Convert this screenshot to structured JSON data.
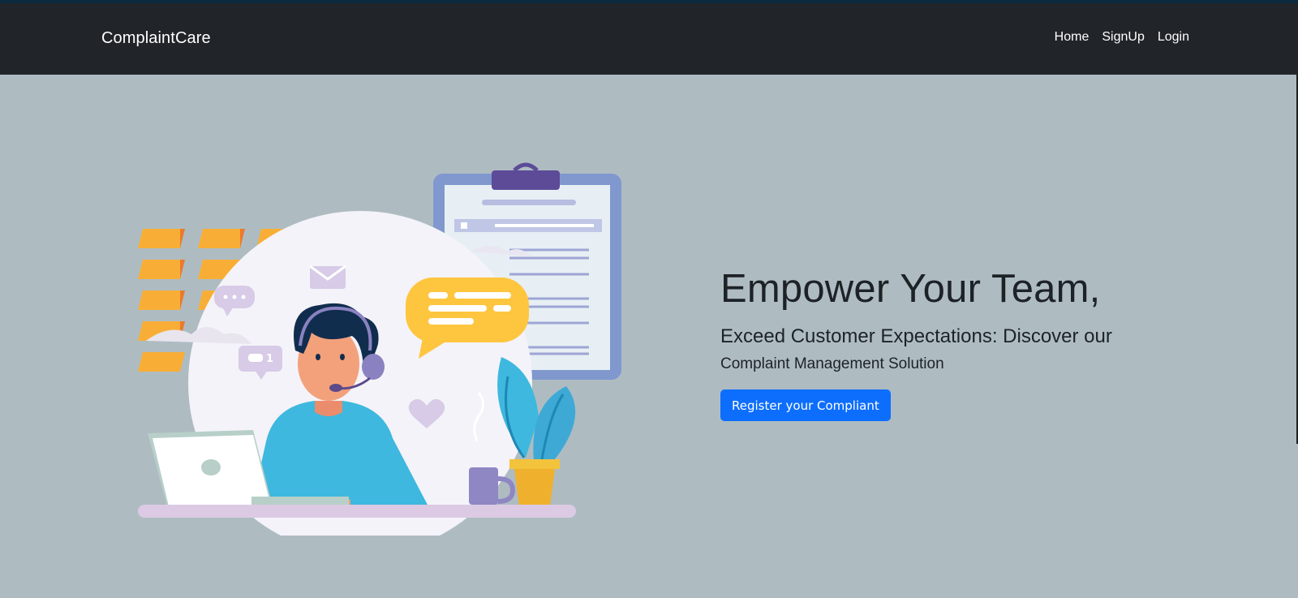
{
  "nav": {
    "brand": "ComplaintCare",
    "links": [
      {
        "label": "Home"
      },
      {
        "label": "SignUp"
      },
      {
        "label": "Login"
      }
    ]
  },
  "hero": {
    "title": "Empower Your Team,",
    "subtitle": "Exceed Customer Expectations: Discover our",
    "subtitle2": "Complaint Management Solution",
    "cta_label": "Register your Compliant",
    "illustration_icon": "customer-support-illustration",
    "chat_badge_count": "1"
  },
  "colors": {
    "navbar": "#212529",
    "background": "#aebcc2",
    "cta": "#0d6efd"
  }
}
